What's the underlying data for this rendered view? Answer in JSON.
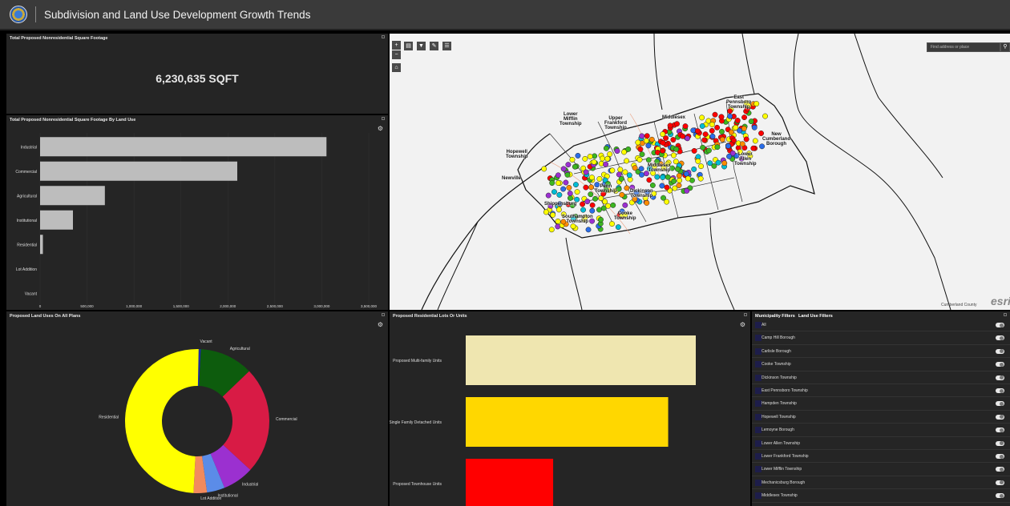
{
  "app": {
    "title": "Subdivision and Land Use Development Growth Trends"
  },
  "panel_total": {
    "title": "Total Proposed Nonresidential Square Footage",
    "value": "6,230,635 SQFT"
  },
  "panel_bylanduse": {
    "title": "Total Proposed Nonresidential Square Footage By Land Use",
    "chart_data": {
      "type": "bar",
      "orientation": "horizontal",
      "categories": [
        "Industrial",
        "Commercial",
        "Agricultural",
        "Institutional",
        "Residential",
        "Lot Addition",
        "Vacant"
      ],
      "values": [
        3050000,
        2100000,
        690000,
        350000,
        30000,
        0,
        0
      ],
      "xlim": [
        0,
        3500000
      ],
      "xticks": [
        "0",
        "500,000",
        "1,000,000",
        "1,500,000",
        "2,000,000",
        "2,500,000",
        "3,000,000",
        "3,500,000"
      ],
      "bar_color": "#bdbdbd"
    }
  },
  "panel_donut": {
    "title": "Proposed Land Uses On All Plans",
    "chart_data": {
      "type": "pie",
      "donut": true,
      "slices": [
        {
          "label": "Vacant",
          "value": 0.5,
          "color": "#1a2aa8"
        },
        {
          "label": "Agricultural",
          "value": 12,
          "color": "#0d5c0d"
        },
        {
          "label": "Commercial",
          "value": 24,
          "color": "#d81b45"
        },
        {
          "label": "Industrial",
          "value": 7,
          "color": "#9b30d0"
        },
        {
          "label": "Institutional",
          "value": 4,
          "color": "#5b8ce8"
        },
        {
          "label": "Lot Addition",
          "value": 3,
          "color": "#f28a5e"
        },
        {
          "label": "Residential",
          "value": 49.5,
          "color": "#ffff00"
        }
      ]
    }
  },
  "panel_residential": {
    "title": "Proposed Residential Lots Or Units",
    "chart_data": {
      "type": "bar",
      "orientation": "horizontal",
      "categories": [
        "Proposed Multi-family Units",
        "Proposed Single Family Detached Units",
        "Proposed Townhouse Units"
      ],
      "values": [
        100,
        88,
        38
      ],
      "colors": [
        "#efe6b0",
        "#ffd700",
        "#ff0000"
      ]
    }
  },
  "panel_filters": {
    "tabs": [
      "Municipality Filters",
      "Land Use Filters"
    ],
    "items": [
      "All",
      "Camp Hill Borough",
      "Carlisle Borough",
      "Cooke Township",
      "Dickinson Township",
      "East Pennsboro Township",
      "Hampden Township",
      "Hopewell Township",
      "Lemoyne Borough",
      "Lower Allen Township",
      "Lower Frankford Township",
      "Lower Mifflin Township",
      "Mechanicsburg Borough",
      "Middlesex Township"
    ]
  },
  "map": {
    "search_placeholder": "Find address or place",
    "credit": "Cumberland County",
    "esri": "esri",
    "tools": [
      "+",
      "−",
      "⌂"
    ],
    "toolbar_icons": [
      "list-icon",
      "table-icon",
      "filter-icon",
      "select-icon",
      "legend-icon"
    ],
    "labels": [
      {
        "text": "East\nPennsboro\nTownship"
      },
      {
        "text": "Lower\nMifflin\nTownship"
      },
      {
        "text": "Upper\nFrankford\nTownship"
      },
      {
        "text": "Middlesex"
      },
      {
        "text": "New\nCumberland\nBorough"
      },
      {
        "text": "Lower\nAllen\nTownship"
      },
      {
        "text": "Hopewell\nTownship"
      },
      {
        "text": "Newville"
      },
      {
        "text": "Penn\nTownship"
      },
      {
        "text": "Dickinson\nTownship"
      },
      {
        "text": "Middlesex\nTownship"
      },
      {
        "text": "Southampton\nTownship"
      },
      {
        "text": "Cooke\nTownship"
      },
      {
        "text": "Shippensburg"
      }
    ]
  }
}
